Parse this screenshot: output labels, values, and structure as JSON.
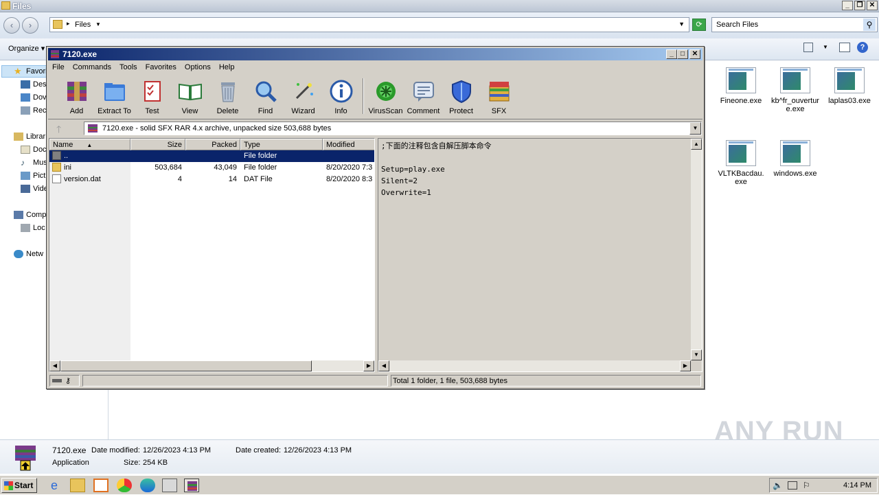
{
  "explorer": {
    "title": "Files",
    "address": "Files",
    "search_placeholder": "Search Files",
    "organize_label": "Organize",
    "nav": {
      "favorites": "Favori",
      "items": [
        "Des",
        "Dov",
        "Rec"
      ],
      "libraries": "Librar",
      "lib_items": [
        "Doc",
        "Mus",
        "Pict",
        "Vide"
      ],
      "computer": "Comp",
      "comp_items": [
        "Loc"
      ],
      "network": "Netw"
    },
    "files": [
      {
        "name": "Fineone.exe"
      },
      {
        "name": "kb^fr_ouverture.exe"
      },
      {
        "name": "laplas03.exe"
      },
      {
        "name": "VLTKBacdau.exe"
      },
      {
        "name": "windows.exe"
      }
    ],
    "details": {
      "filename": "7120.exe",
      "type": "Application",
      "modified_label": "Date modified:",
      "modified_value": "12/26/2023 4:13 PM",
      "created_label": "Date created:",
      "created_value": "12/26/2023 4:13 PM",
      "size_label": "Size:",
      "size_value": "254 KB"
    },
    "watermark": "ANY RUN"
  },
  "rar": {
    "title": "7120.exe",
    "menu": [
      "File",
      "Commands",
      "Tools",
      "Favorites",
      "Options",
      "Help"
    ],
    "toolbar": [
      {
        "label": "Add",
        "icon": "add-archive-icon"
      },
      {
        "label": "Extract To",
        "icon": "extract-folder-icon"
      },
      {
        "label": "Test",
        "icon": "test-checklist-icon"
      },
      {
        "label": "View",
        "icon": "view-book-icon"
      },
      {
        "label": "Delete",
        "icon": "trash-icon"
      },
      {
        "label": "Find",
        "icon": "magnifier-icon"
      },
      {
        "label": "Wizard",
        "icon": "magic-wand-icon"
      },
      {
        "label": "Info",
        "icon": "info-icon"
      },
      {
        "label": "VirusScan",
        "icon": "virus-icon"
      },
      {
        "label": "Comment",
        "icon": "comment-icon"
      },
      {
        "label": "Protect",
        "icon": "shield-icon"
      },
      {
        "label": "SFX",
        "icon": "sfx-box-icon"
      }
    ],
    "path": "7120.exe - solid SFX RAR 4.x archive, unpacked size 503,688 bytes",
    "columns": [
      "Name",
      "Size",
      "Packed",
      "Type",
      "Modified"
    ],
    "rows": [
      {
        "name": "..",
        "size": "",
        "packed": "",
        "type": "File folder",
        "modified": ""
      },
      {
        "name": "ini",
        "size": "503,684",
        "packed": "43,049",
        "type": "File folder",
        "modified": "8/20/2020 7:3"
      },
      {
        "name": "version.dat",
        "size": "4",
        "packed": "14",
        "type": "DAT File",
        "modified": "8/20/2020 8:3"
      }
    ],
    "comment": ";下面的注释包含自解压脚本命令\n\nSetup=play.exe\nSilent=2\nOverwrite=1",
    "status": "Total 1 folder, 1 file, 503,688 bytes"
  },
  "taskbar": {
    "start": "Start",
    "time": "4:14 PM"
  },
  "colors": {
    "rar_title_start": "#0a246a",
    "rar_title_end": "#a6caf0",
    "selection": "#0a246a"
  }
}
